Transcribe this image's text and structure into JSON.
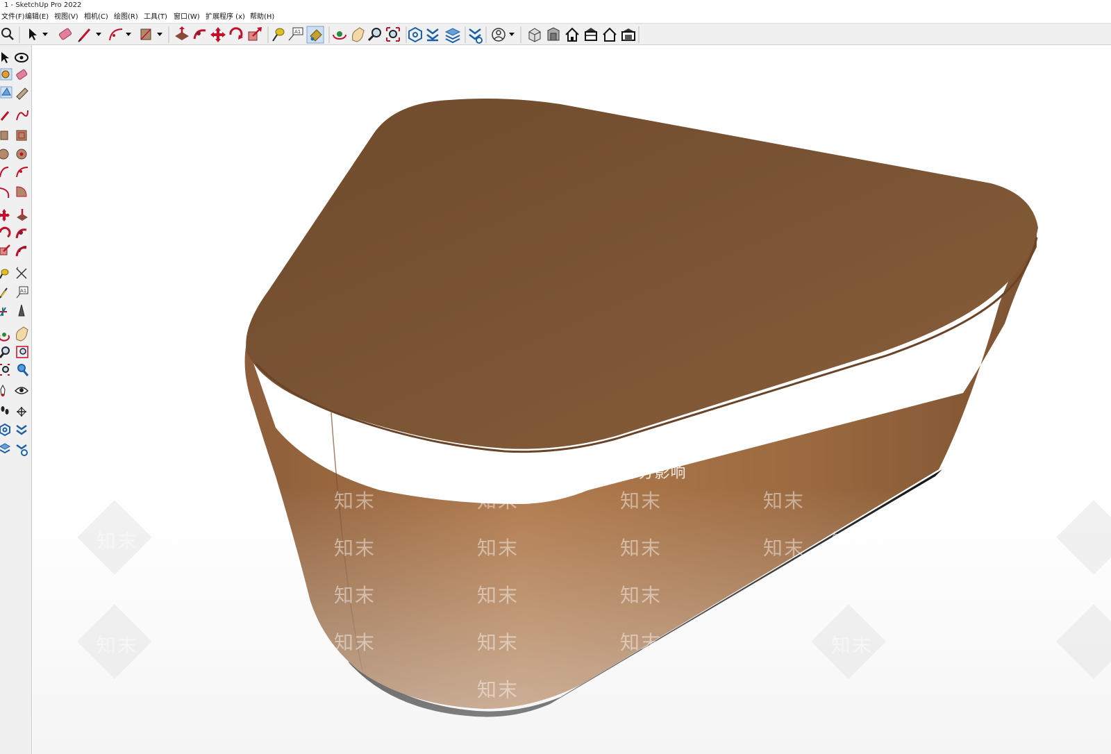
{
  "window": {
    "title": "1 - SketchUp Pro 2022"
  },
  "menu": {
    "items": [
      {
        "label": "文件(F)"
      },
      {
        "label": "编辑(E)"
      },
      {
        "label": "视图(V)"
      },
      {
        "label": "相机(C)"
      },
      {
        "label": "绘图(R)"
      },
      {
        "label": "工具(T)"
      },
      {
        "label": "窗口(W)"
      },
      {
        "label": "扩展程序 (x)"
      },
      {
        "label": "帮助(H)"
      }
    ]
  },
  "toolbar": {
    "icons": [
      "zoom-icon",
      "select-icon",
      "dropdown-icon",
      "eraser-icon",
      "pencil-line-icon",
      "dropdown-icon",
      "arc-icon",
      "dropdown-icon",
      "rectangle-icon",
      "dropdown-icon",
      "push-pull-icon",
      "follow-me-icon",
      "move-icon",
      "rotate-icon",
      "scale-icon",
      "tape-measure-icon",
      "text-label-icon",
      "paint-bucket-icon",
      "orbit-icon",
      "pan-icon",
      "zoom-tool-icon",
      "zoom-extents-icon",
      "warehouse-icon",
      "extension-icon",
      "layers-icon",
      "extension-manager-icon",
      "account-icon",
      "dropdown-icon",
      "iso-view-icon",
      "front-view-icon",
      "home-view-icon",
      "top-view-icon",
      "house-view-icon",
      "back-view-icon"
    ]
  },
  "sidebar": {
    "icons": [
      "select-icon",
      "orbit-icon",
      "component-icon",
      "eraser-icon",
      "materials-icon",
      "tag-icon",
      "line-icon",
      "freehand-icon",
      "rectangle-icon",
      "rotated-rectangle-icon",
      "circle-icon",
      "polygon-icon",
      "arc-icon",
      "pie-icon",
      "two-point-arc-icon",
      "three-point-arc-icon",
      "move-icon",
      "push-pull-icon",
      "rotate-icon",
      "follow-me-icon",
      "scale-icon",
      "offset-icon",
      "tape-measure-icon",
      "dimension-icon",
      "protractor-icon",
      "text-icon",
      "axes-icon",
      "3d-text-icon",
      "section-plane-icon",
      "paint-icon",
      "zoom-icon",
      "zoom-window-icon",
      "zoom-extents-icon",
      "previous-view-icon",
      "position-camera-icon",
      "look-around-icon",
      "walk-icon",
      "section-icon",
      "warehouse-icon",
      "extension-icon",
      "layers-icon",
      "settings-icon"
    ]
  },
  "viewport": {
    "model": "triangular-ottoman",
    "colors": {
      "leather_top": "#7a5534",
      "leather_side": "#9c6b43",
      "base": "#1a1a1a"
    },
    "watermark": {
      "banner": "水印保护区  画质会受到部分影响",
      "text": "知末"
    }
  }
}
